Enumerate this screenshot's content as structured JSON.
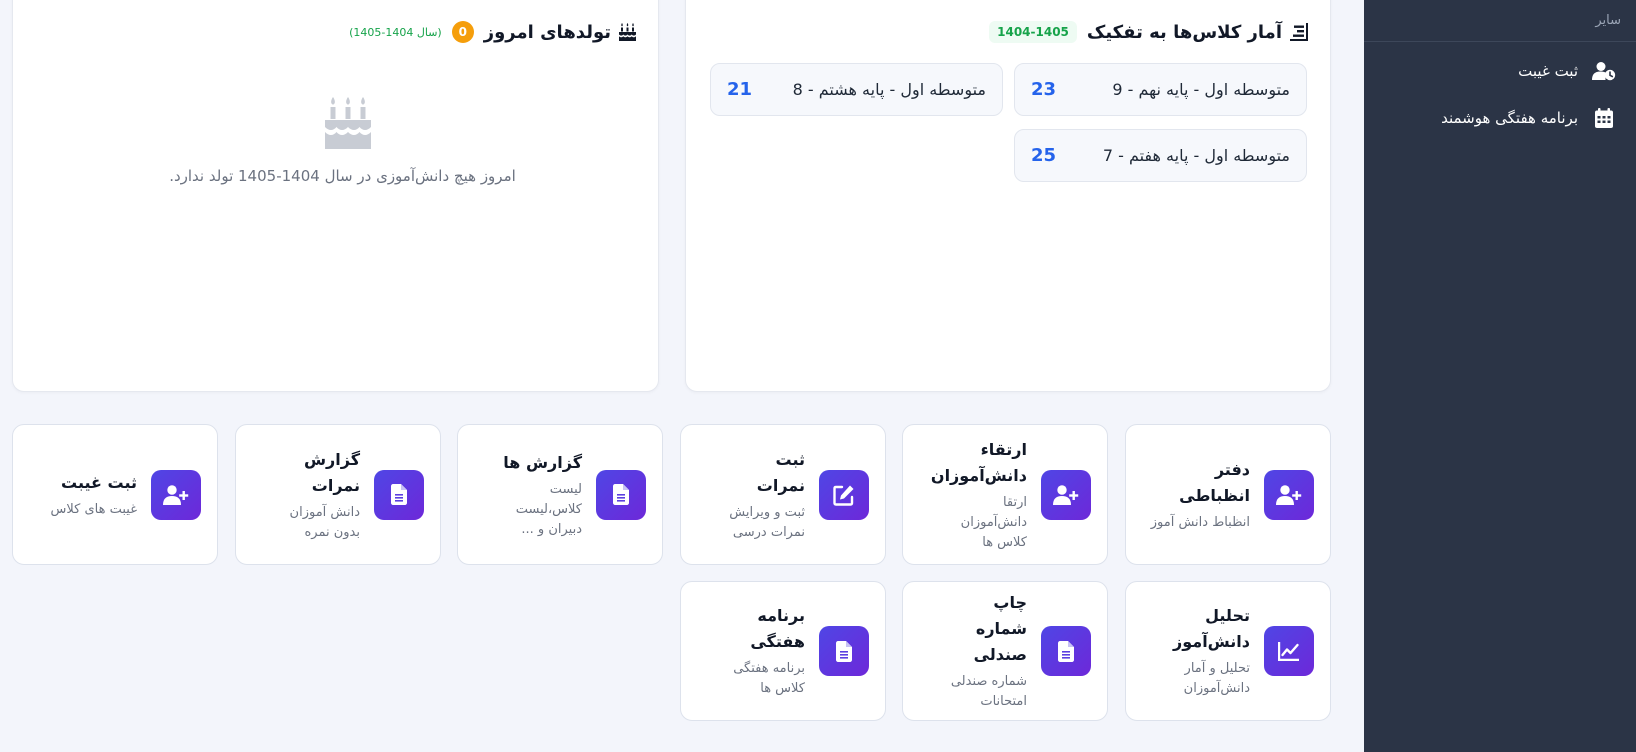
{
  "sidebar": {
    "section_label": "سایر",
    "items": [
      {
        "label": "ثبت غیبت",
        "icon": "user-clock-icon"
      },
      {
        "label": "برنامه هفتگی هوشمند",
        "icon": "calendar-icon"
      }
    ]
  },
  "class_stats": {
    "title": "آمار کلاس‌ها به تفکیک",
    "year": "1404-1405",
    "icon": "list-icon",
    "classes": [
      {
        "name": "متوسطه اول - پایه نهم - 9",
        "count": "23"
      },
      {
        "name": "متوسطه اول - پایه هشتم - 8",
        "count": "21"
      },
      {
        "name": "متوسطه اول - پایه هفتم - 7",
        "count": "25"
      }
    ]
  },
  "birthdays": {
    "title": "تولدهای امروز",
    "count": "0",
    "year_note": "(سال 1404-1405)",
    "empty_message": "امروز هیچ دانش‌آموزی در سال 1404-1405 تولد ندارد.",
    "icon": "birthday-cake-icon"
  },
  "tiles": [
    {
      "title": "دفتر انظباطی",
      "subtitle": "انظباط دانش آموز",
      "icon": "user-plus-icon"
    },
    {
      "title": "ارتقاء دانش‌آموزان",
      "subtitle": "ارتقا دانش‌آموزان کلاس ها",
      "icon": "user-plus-icon"
    },
    {
      "title": "ثبت نمرات",
      "subtitle": "ثبت و ویرایش نمرات درسی",
      "icon": "edit-icon"
    },
    {
      "title": "گزارش ها",
      "subtitle": "لیست کلاس،لیست دبیران و ...",
      "icon": "file-icon"
    },
    {
      "title": "گزارش نمرات",
      "subtitle": "دانش آموزان بدون نمره",
      "icon": "file-icon"
    },
    {
      "title": "ثبت غیبت",
      "subtitle": "غیبت های کلاس",
      "icon": "user-plus-icon"
    },
    {
      "title": "تحلیل دانش‌آموز",
      "subtitle": "تحلیل و آمار دانش‌آموزان",
      "icon": "chart-line-icon"
    },
    {
      "title": "چاپ شماره صندلی",
      "subtitle": "شماره صندلی امتحانات",
      "icon": "file-icon"
    },
    {
      "title": "برنامه هفتگی",
      "subtitle": "برنامه هفتگی کلاس ها",
      "icon": "file-icon"
    }
  ],
  "colors": {
    "sidebar_bg": "#2b3446",
    "accent_gradient_start": "#4f46e5",
    "accent_gradient_end": "#6d28d9",
    "count_blue": "#2563eb",
    "badge_orange": "#f59e0b",
    "year_green": "#16a34a"
  }
}
